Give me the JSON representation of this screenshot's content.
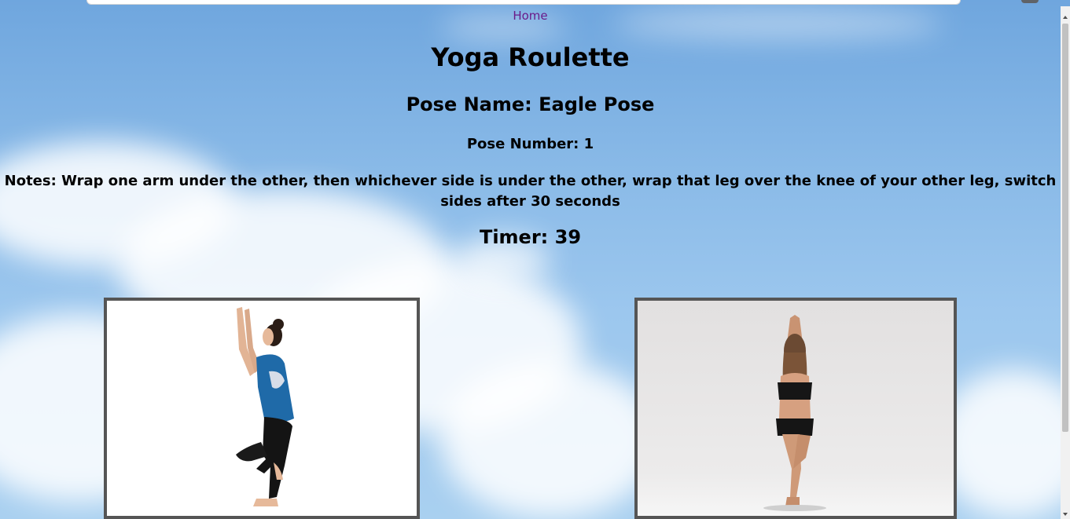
{
  "nav": {
    "home_label": "Home"
  },
  "page": {
    "title": "Yoga Roulette",
    "pose_name": "Pose Name: Eagle Pose",
    "pose_number": "Pose Number: 1",
    "notes": "Notes: Wrap one arm under the other, then whichever side is under the other, wrap that leg over the knee of your other leg, switch sides after 30 seconds",
    "timer": "Timer: 39"
  },
  "images": [
    {
      "icon": "eagle-pose-photo-blue-top"
    },
    {
      "icon": "eagle-pose-photo-black-top"
    }
  ],
  "colors": {
    "link": "#6a1b8a",
    "frame": "#555555",
    "sky": "#8bbbe8"
  }
}
